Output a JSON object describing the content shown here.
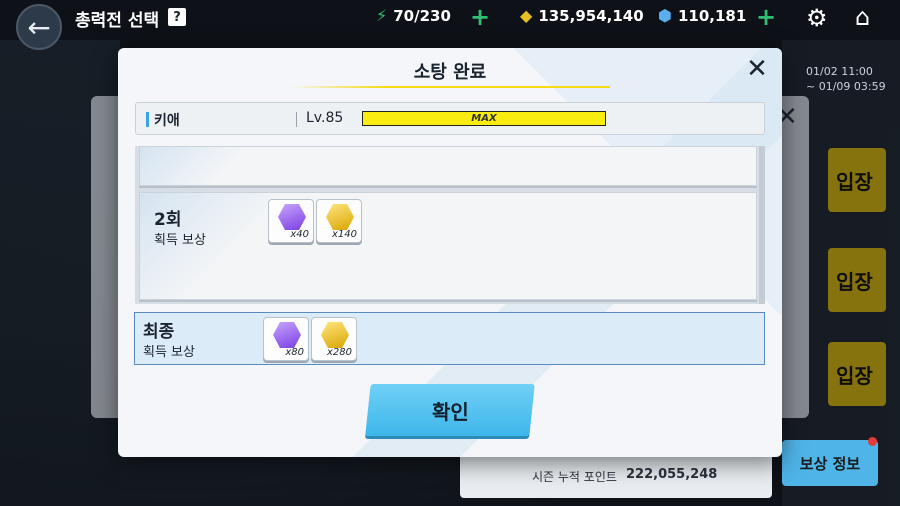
{
  "topbar": {
    "title": "총력전 선택",
    "help": "?",
    "stamina": "70/230",
    "credits": "135,954,140",
    "gems": "110,181",
    "date_range": [
      "01/02 11:00",
      "~ 01/09 03:59"
    ]
  },
  "background": {
    "side_tabs": [
      "입장",
      "입장",
      "입장"
    ],
    "season_points_label": "시즌 누적 포인트",
    "season_points_value": "222,055,248",
    "reward_info_button": "보상 정보"
  },
  "modal": {
    "title": "소탕 완료",
    "character": {
      "name": "키애",
      "level": "Lv.85",
      "exp_label": "MAX",
      "exp_fraction": 1.0
    },
    "rounds": [
      {
        "title": "2회",
        "subtitle": "획득 보상",
        "items": [
          {
            "icon": "purple-gem-icon",
            "qty": "x40"
          },
          {
            "icon": "gold-gem-icon",
            "qty": "x140"
          }
        ]
      }
    ],
    "final": {
      "title": "최종",
      "subtitle": "획득 보상",
      "items": [
        {
          "icon": "purple-gem-icon",
          "qty": "x80"
        },
        {
          "icon": "gold-gem-icon",
          "qty": "x280"
        }
      ]
    },
    "confirm_label": "확인"
  },
  "colors": {
    "accent_yellow": "#f6da14",
    "confirm_blue": "#4fc0ef",
    "final_highlight": "#dcebf8"
  }
}
